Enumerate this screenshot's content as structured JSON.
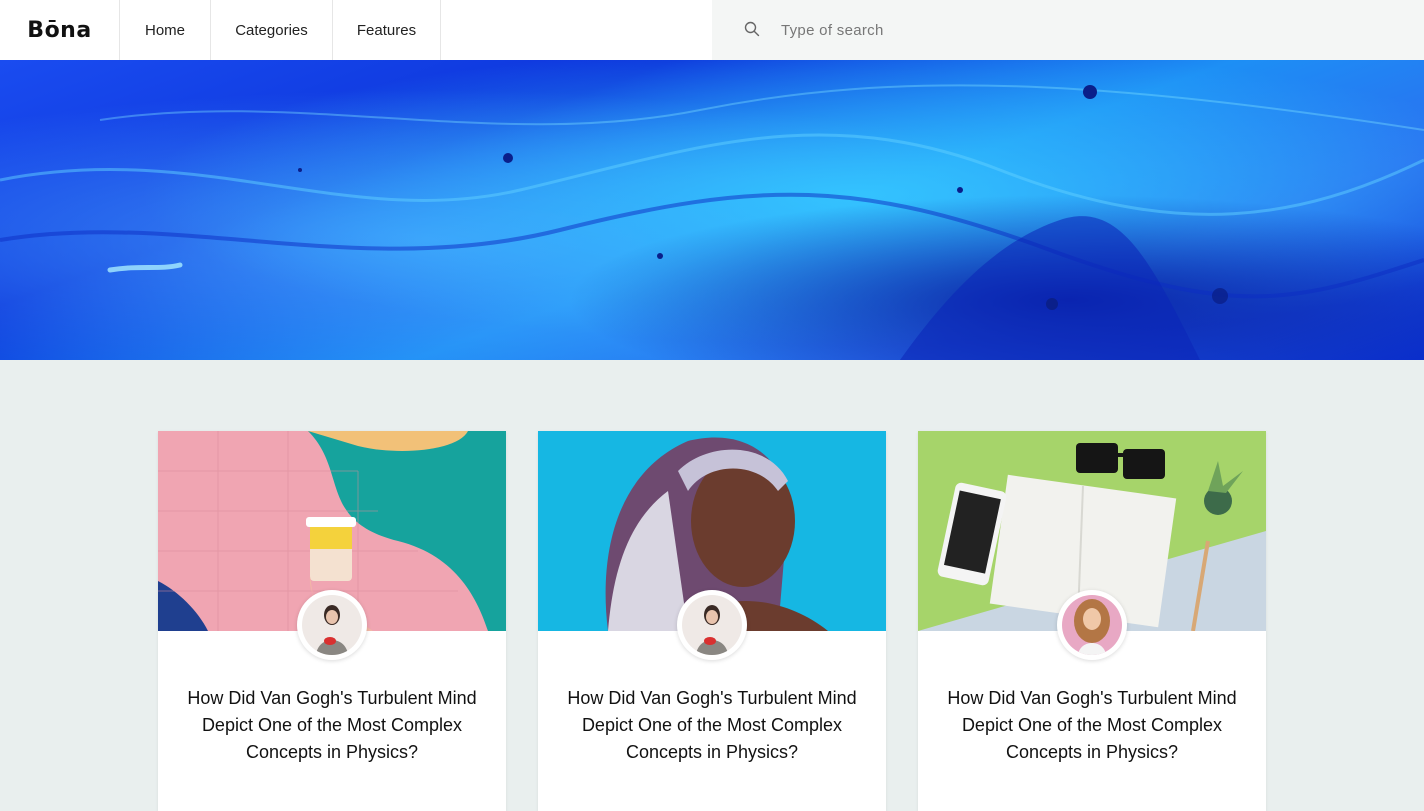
{
  "header": {
    "logo": "Bōna",
    "nav": [
      {
        "label": "Home"
      },
      {
        "label": "Categories"
      },
      {
        "label": "Features"
      }
    ],
    "search": {
      "placeholder": "Type of search",
      "icon": "search-icon"
    }
  },
  "hero": {
    "image": "blue-marbled-paint-texture"
  },
  "cards": [
    {
      "title": "How Did Van Gogh's Turbulent Mind Depict One of the Most Complex Concepts in Physics?",
      "image": "coffee-cup-colorful-wall",
      "avatar": "woman-holding-red-cup"
    },
    {
      "title": "How Did Van Gogh's Turbulent Mind Depict One of the Most Complex Concepts in Physics?",
      "image": "woman-headscarf-portrait",
      "avatar": "woman-holding-red-cup"
    },
    {
      "title": "How Did Van Gogh's Turbulent Mind Depict One of the Most Complex Concepts in Physics?",
      "image": "desk-phone-notebook-sunglasses",
      "avatar": "woman-curly-hair"
    }
  ],
  "colors": {
    "page_bg": "#e9efee",
    "header_bg": "#ffffff",
    "search_bg": "#f4f6f5",
    "hero_blue": "#1a4cf0"
  }
}
